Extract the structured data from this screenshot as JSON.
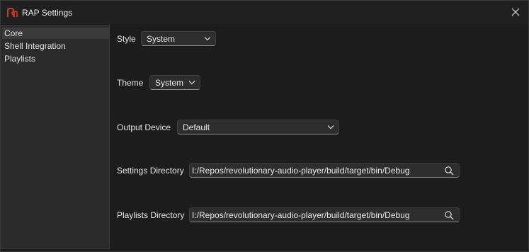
{
  "window": {
    "title": "RAP Settings"
  },
  "sidebar": {
    "items": [
      {
        "label": "Core"
      },
      {
        "label": "Shell Integration"
      },
      {
        "label": "Playlists"
      }
    ]
  },
  "core": {
    "style": {
      "label": "Style",
      "value": "System"
    },
    "theme": {
      "label": "Theme",
      "value": "System"
    },
    "output_device": {
      "label": "Output Device",
      "value": "Default"
    },
    "settings_directory": {
      "label": "Settings Directory",
      "value": "I:/Repos/revolutionary-audio-player/build/target/bin/Debug"
    },
    "playlists_directory": {
      "label": "Playlists Directory",
      "value": "I:/Repos/revolutionary-audio-player/build/target/bin/Debug"
    }
  },
  "colors": {
    "accent": "#c0392b",
    "window_bg": "#1c1c1c",
    "sidebar_bg": "#2b2b2b"
  },
  "icons": {
    "app": "rap-logo-icon",
    "close": "close-icon",
    "dropdown": "chevron-down-icon",
    "browse": "search-icon"
  }
}
